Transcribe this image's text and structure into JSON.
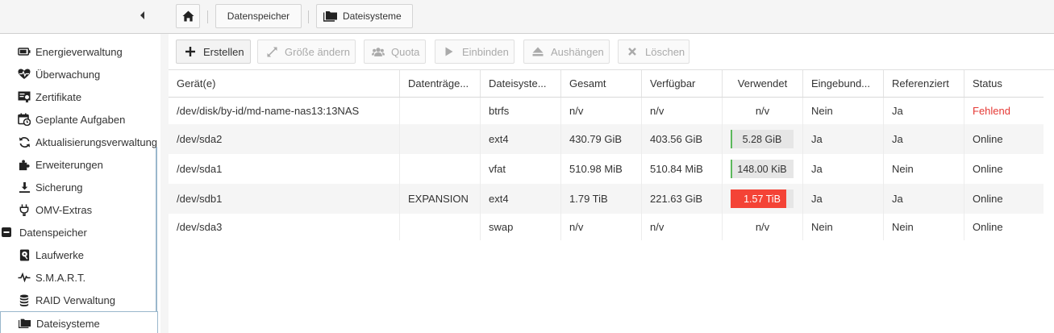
{
  "breadcrumb": {
    "home_icon": "home-icon",
    "items": [
      "Datenspeicher",
      "Dateisysteme"
    ]
  },
  "sidebar": {
    "items": [
      {
        "label": "Energieverwaltung",
        "icon": "battery-icon"
      },
      {
        "label": "Überwachung",
        "icon": "heart-pulse-icon"
      },
      {
        "label": "Zertifikate",
        "icon": "certificate-icon"
      },
      {
        "label": "Geplante Aufgaben",
        "icon": "calendar-clock-icon"
      },
      {
        "label": "Aktualisierungsverwaltung",
        "icon": "refresh-icon"
      },
      {
        "label": "Erweiterungen",
        "icon": "puzzle-icon"
      },
      {
        "label": "Sicherung",
        "icon": "download-tray-icon"
      },
      {
        "label": "OMV-Extras",
        "icon": "plug-icon"
      }
    ],
    "group": {
      "label": "Datenspeicher",
      "icon": "collapse-minus-icon"
    },
    "subitems": [
      {
        "label": "Laufwerke",
        "icon": "harddisk-icon"
      },
      {
        "label": "S.M.A.R.T.",
        "icon": "pulse-icon"
      },
      {
        "label": "RAID Verwaltung",
        "icon": "database-icon"
      },
      {
        "label": "Dateisysteme",
        "icon": "folders-icon"
      }
    ]
  },
  "toolbar": {
    "buttons": [
      {
        "label": "Erstellen",
        "icon": "plus-icon",
        "enabled": true
      },
      {
        "label": "Größe ändern",
        "icon": "resize-icon",
        "enabled": false
      },
      {
        "label": "Quota",
        "icon": "users-icon",
        "enabled": false
      },
      {
        "label": "Einbinden",
        "icon": "play-icon",
        "enabled": false
      },
      {
        "label": "Aushängen",
        "icon": "eject-icon",
        "enabled": false
      },
      {
        "label": "Löschen",
        "icon": "close-icon",
        "enabled": false
      }
    ]
  },
  "grid": {
    "columns": [
      "Gerät(e)",
      "Datenträge...",
      "Dateisyste...",
      "Gesamt",
      "Verfügbar",
      "Verwendet",
      "Eingebund...",
      "Referenziert",
      "Status"
    ],
    "rows": [
      {
        "device": "/dev/disk/by-id/md-name-nas13:13NAS",
        "label": "",
        "fs": "btrfs",
        "total": "n/v",
        "available": "n/v",
        "used": "n/v",
        "used_fraction": null,
        "mounted": "Nein",
        "referenced": "Ja",
        "status": "Fehlend"
      },
      {
        "device": "/dev/sda2",
        "label": "",
        "fs": "ext4",
        "total": "430.79 GiB",
        "available": "403.56 GiB",
        "used": "5.28 GiB",
        "used_fraction": 0.02,
        "mounted": "Ja",
        "referenced": "Ja",
        "status": "Online"
      },
      {
        "device": "/dev/sda1",
        "label": "",
        "fs": "vfat",
        "total": "510.98 MiB",
        "available": "510.84 MiB",
        "used": "148.00 KiB",
        "used_fraction": 0.01,
        "mounted": "Ja",
        "referenced": "Nein",
        "status": "Online"
      },
      {
        "device": "/dev/sdb1",
        "label": "EXPANSION",
        "fs": "ext4",
        "total": "1.79 TiB",
        "available": "221.63 GiB",
        "used": "1.57 TiB",
        "used_fraction": 0.88,
        "mounted": "Ja",
        "referenced": "Ja",
        "status": "Online"
      },
      {
        "device": "/dev/sda3",
        "label": "",
        "fs": "swap",
        "total": "n/v",
        "available": "n/v",
        "used": "n/v",
        "used_fraction": null,
        "mounted": "Nein",
        "referenced": "Nein",
        "status": "Online"
      }
    ]
  },
  "colors": {
    "usage_ok": "#5cb85c",
    "usage_full": "#f44336",
    "status_missing": "#e53935"
  }
}
